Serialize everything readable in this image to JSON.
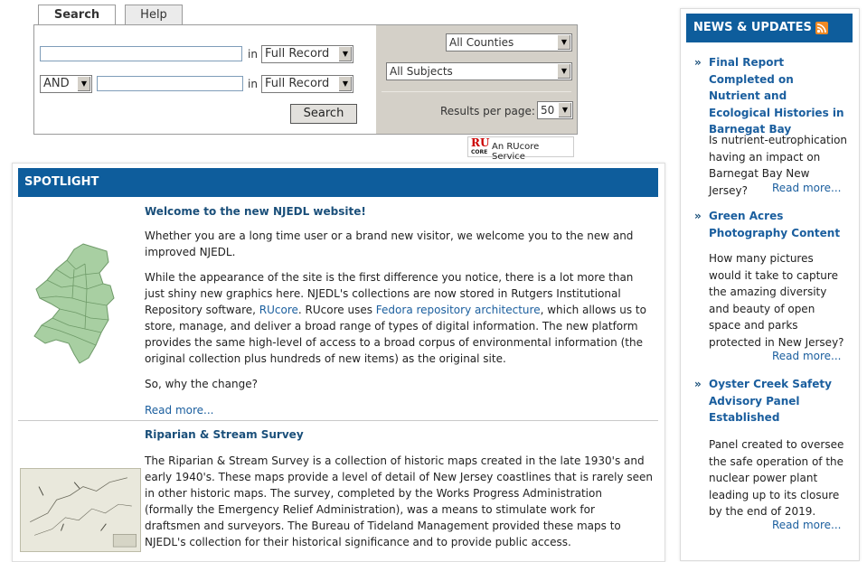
{
  "search": {
    "tabs": [
      "Search",
      "Help"
    ],
    "row1": {
      "value": "",
      "in_label": "in",
      "field": "Full Record"
    },
    "row2": {
      "operator": "AND",
      "value": "",
      "in_label": "in",
      "field": "Full Record"
    },
    "counties": "All Counties",
    "subjects": "All Subjects",
    "results_label": "Results per page:",
    "results_value": "50",
    "button": "Search"
  },
  "badge": {
    "logo_top": "RU",
    "logo_bottom": "CORE",
    "text": "An RUcore Service"
  },
  "spotlight": {
    "header": "SPOTLIGHT",
    "articles": [
      {
        "title": "Welcome to the new NJEDL website!",
        "p1": "Whether you are a long time user or a brand new visitor, we welcome you to the new and improved NJEDL.",
        "p2a": "While the appearance of the site is the first difference you notice, there is a lot more than just shiny new graphics here.  NJEDL's collections are now stored in Rutgers Institutional Repository software, ",
        "p2_link1": "RUcore",
        "p2b": ".  RUcore uses ",
        "p2_link2": "Fedora repository architecture",
        "p2c": ", which allows us to store, manage, and deliver a broad range of types of digital information.  The new platform provides the same high-level of access to a broad corpus of environmental information (the original collection plus hundreds of new items) as the original site.",
        "p3": "So, why the change?",
        "more": "Read more..."
      },
      {
        "title": "Riparian & Stream Survey",
        "p1": "The Riparian & Stream Survey is a collection of historic maps created in the late 1930's and early 1940's.  These maps provide a level of detail of New Jersey coastlines that is rarely seen in other historic maps.  The survey, completed by the Works Progress Administration (formally the Emergency Relief Administration), was a means to stimulate work for draftsmen and surveyors. The Bureau of Tideland Management provided these maps to NJEDL's collection for their historical significance and to provide public access."
      }
    ]
  },
  "news": {
    "header": "NEWS & UPDATES",
    "bullet": "»",
    "items": [
      {
        "title": "Final Report Completed on Nutrient and Ecological Histories in Barnegat Bay",
        "desc": "Is nutrient-eutrophication having an impact on Barnegat Bay New Jersey?",
        "more": "Read more..."
      },
      {
        "title": "Green Acres Photography Content",
        "desc": "How many pictures would it take to capture the amazing diversity and beauty of open space and parks protected in New Jersey?",
        "more": "Read more..."
      },
      {
        "title": "Oyster Creek Safety Advisory Panel Established",
        "desc": "Panel created to oversee the safe operation of the nuclear power plant leading up to its closure by the end of 2019.",
        "more": "Read more..."
      }
    ]
  }
}
